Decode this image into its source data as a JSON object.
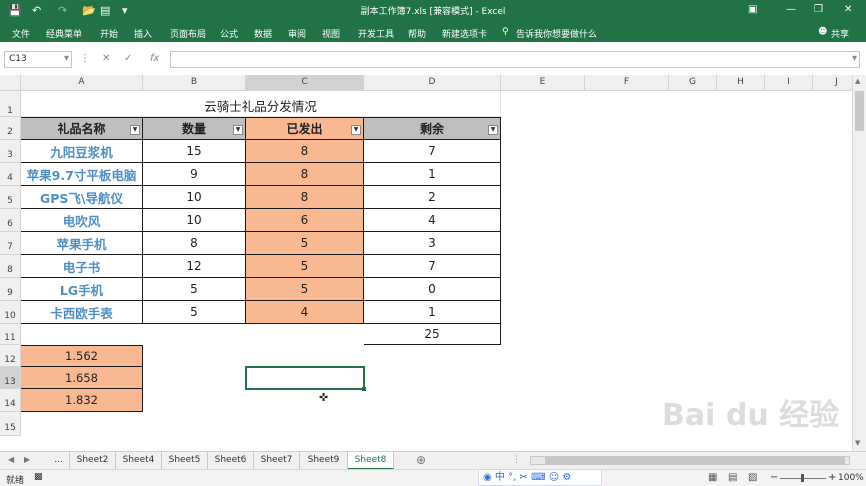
{
  "window": {
    "title": "副本工作簿7.xls  [兼容模式]  -  Excel",
    "save_icon": "save-icon",
    "undo_icon": "undo-icon",
    "redo_icon": "redo-icon"
  },
  "ribbon": {
    "tabs": [
      "文件",
      "经典菜单",
      "开始",
      "插入",
      "页面布局",
      "公式",
      "数据",
      "审阅",
      "视图",
      "开发工具",
      "帮助",
      "新建选项卡"
    ],
    "tell_me": "告诉我你想要做什么",
    "share": "共享"
  },
  "formula_bar": {
    "name_box": "C13",
    "fx": "fx",
    "value": ""
  },
  "columns": [
    "A",
    "B",
    "C",
    "D",
    "E",
    "F",
    "G",
    "H",
    "I",
    "J"
  ],
  "rows": [
    "1",
    "2",
    "3",
    "4",
    "5",
    "6",
    "7",
    "8",
    "9",
    "10",
    "11",
    "12",
    "13",
    "14",
    "15"
  ],
  "sheet": {
    "title": "云骑士礼品分发情况",
    "headers": [
      "礼品名称",
      "数量",
      "已发出",
      "剩余"
    ],
    "data": [
      [
        "九阳豆浆机",
        "15",
        "8",
        "7"
      ],
      [
        "苹果9.7寸平板电脑",
        "9",
        "8",
        "1"
      ],
      [
        "GPS飞\\导航仪",
        "10",
        "8",
        "2"
      ],
      [
        "电吹风",
        "10",
        "6",
        "4"
      ],
      [
        "苹果手机",
        "8",
        "5",
        "3"
      ],
      [
        "电子书",
        "12",
        "5",
        "7"
      ],
      [
        "LG手机",
        "5",
        "5",
        "0"
      ],
      [
        "卡西欧手表",
        "5",
        "4",
        "1"
      ]
    ],
    "total": "25",
    "extra": [
      "1.562",
      "1.658",
      "1.832"
    ]
  },
  "sheet_tabs": [
    "...",
    "Sheet2",
    "Sheet4",
    "Sheet5",
    "Sheet6",
    "Sheet7",
    "Sheet9",
    "Sheet8"
  ],
  "active_sheet": "Sheet8",
  "status": {
    "ready": "就绪",
    "zoom": "100%"
  },
  "ime": {
    "lang": "中"
  },
  "watermark": "Bai du 经验",
  "colors": {
    "excel_green": "#217346",
    "header_grey": "#bfbfbf",
    "orange_fill": "#f8b992",
    "name_blue": "#4f8fc4"
  }
}
